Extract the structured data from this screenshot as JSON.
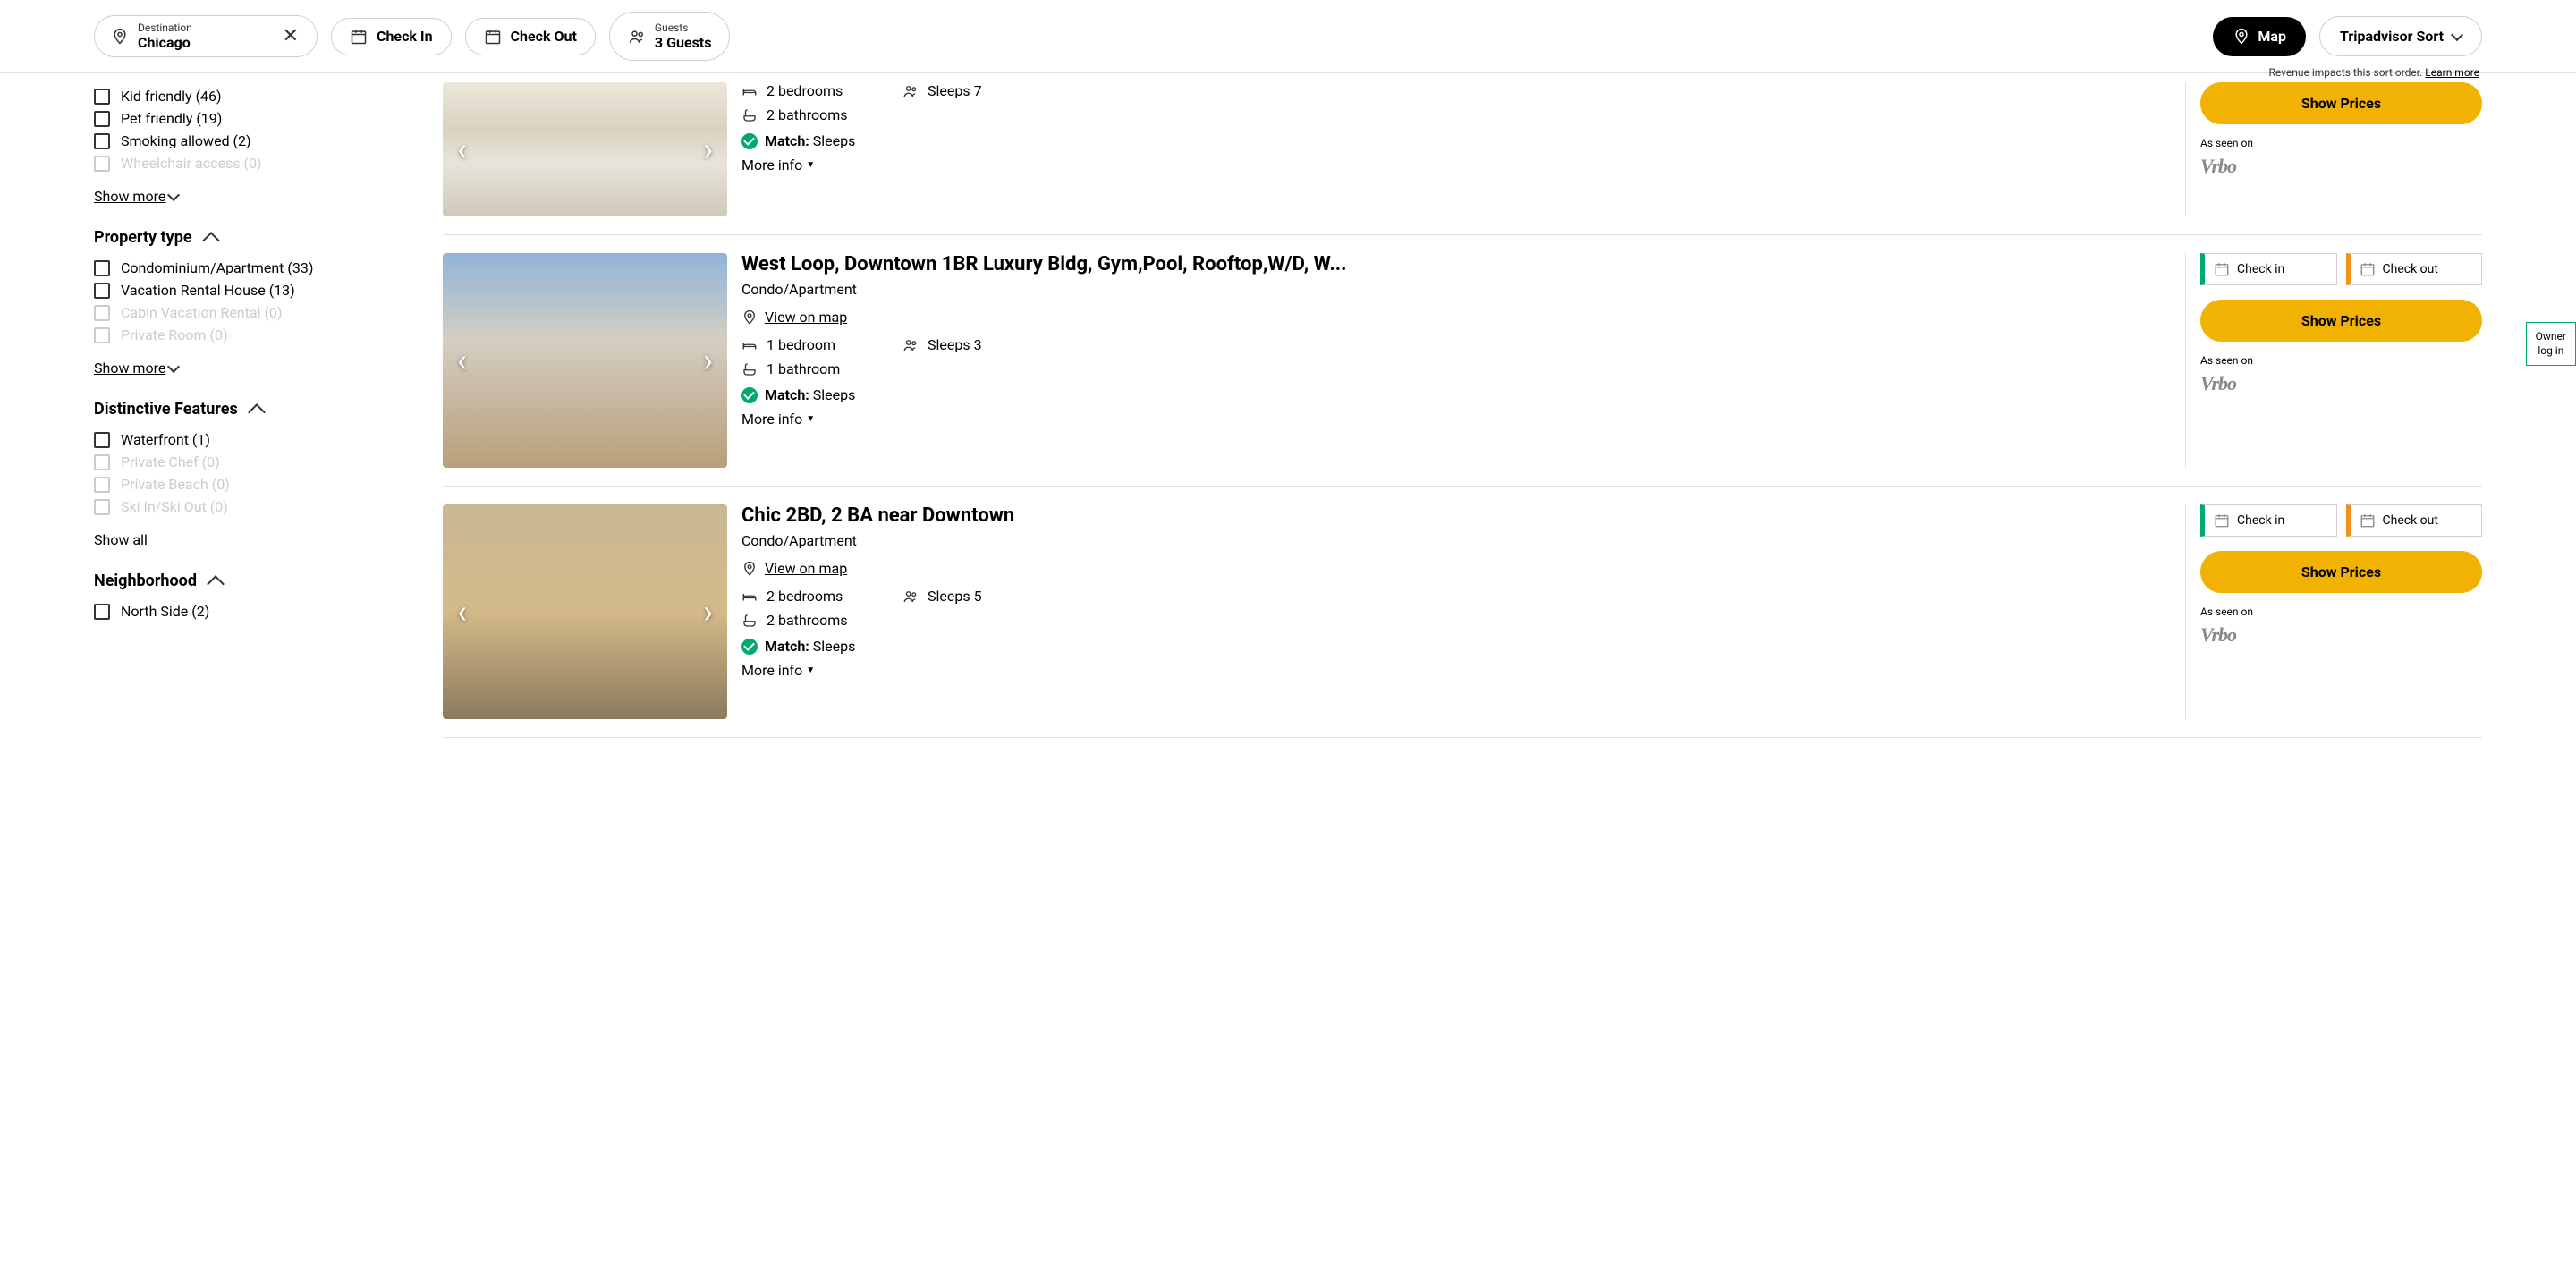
{
  "header": {
    "destination_label": "Destination",
    "destination_value": "Chicago",
    "check_in": "Check In",
    "check_out": "Check Out",
    "guests_label": "Guests",
    "guests_value": "3 Guests",
    "map_button": "Map",
    "sort_button": "Tripadvisor Sort",
    "revenue_note": "Revenue impacts this sort order.",
    "learn_more": "Learn more"
  },
  "sidebar": {
    "show_more": "Show more",
    "show_all": "Show all",
    "suitability": {
      "items": [
        {
          "label": "Kid friendly (46)",
          "enabled": true
        },
        {
          "label": "Pet friendly (19)",
          "enabled": true
        },
        {
          "label": "Smoking allowed (2)",
          "enabled": true
        },
        {
          "label": "Wheelchair access (0)",
          "enabled": false
        }
      ]
    },
    "property_type": {
      "title": "Property type",
      "items": [
        {
          "label": "Condominium/Apartment (33)",
          "enabled": true
        },
        {
          "label": "Vacation Rental House (13)",
          "enabled": true
        },
        {
          "label": "Cabin Vacation Rental (0)",
          "enabled": false
        },
        {
          "label": "Private Room (0)",
          "enabled": false
        }
      ]
    },
    "distinctive": {
      "title": "Distinctive Features",
      "items": [
        {
          "label": "Waterfront (1)",
          "enabled": true
        },
        {
          "label": "Private Chef (0)",
          "enabled": false
        },
        {
          "label": "Private Beach (0)",
          "enabled": false
        },
        {
          "label": "Ski In/Ski Out (0)",
          "enabled": false
        }
      ]
    },
    "neighborhood": {
      "title": "Neighborhood",
      "items": [
        {
          "label": "North Side (2)",
          "enabled": true
        }
      ]
    }
  },
  "common": {
    "view_on_map": "View on map",
    "match_label": "Match:",
    "match_value": "Sleeps",
    "more_info": "More info",
    "check_in": "Check in",
    "check_out": "Check out",
    "show_prices": "Show Prices",
    "as_seen": "As seen on",
    "vrbo": "Vrbo"
  },
  "listings": [
    {
      "title": "",
      "type": "",
      "bedrooms": "2 bedrooms",
      "bathrooms": "2 bathrooms",
      "sleeps": "Sleeps 7",
      "photo": "bedroom",
      "compact": true
    },
    {
      "title": "West Loop, Downtown 1BR Luxury Bldg, Gym,Pool, Rooftop,W/D, W...",
      "type": "Condo/Apartment",
      "bedrooms": "1 bedroom",
      "bathrooms": "1 bathroom",
      "sleeps": "Sleeps 3",
      "photo": "living",
      "compact": false
    },
    {
      "title": "Chic 2BD, 2 BA near Downtown",
      "type": "Condo/Apartment",
      "bedrooms": "2 bedrooms",
      "bathrooms": "2 bathrooms",
      "sleeps": "Sleeps 5",
      "photo": "kitchen",
      "compact": false
    }
  ],
  "owner_tab": "Owner log in"
}
